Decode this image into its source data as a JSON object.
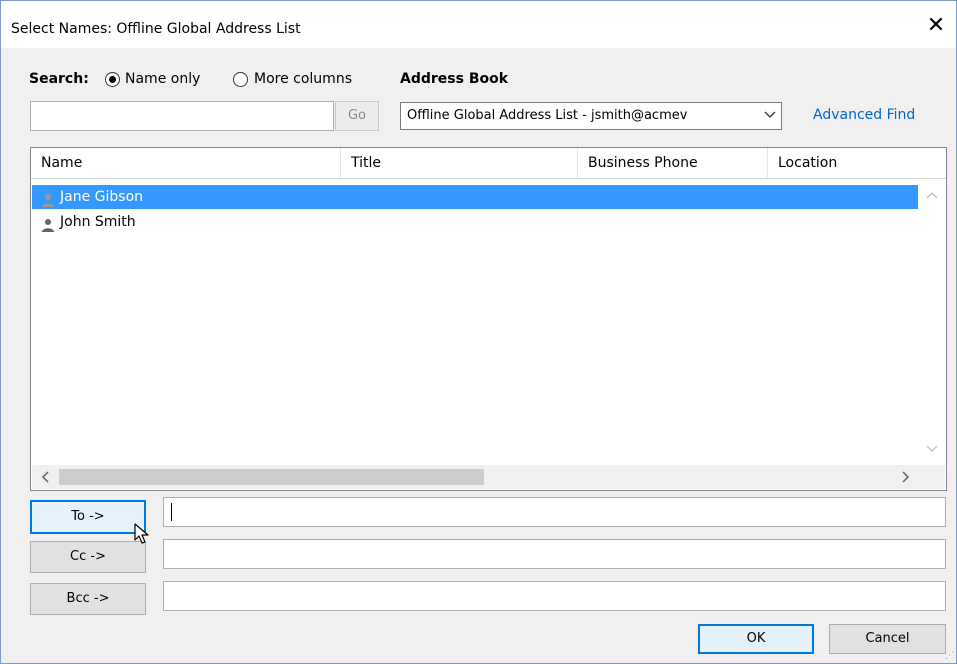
{
  "window": {
    "title": "Select Names: Offline Global Address List"
  },
  "search": {
    "label": "Search:",
    "option_name_only": "Name only",
    "option_more_columns": "More columns",
    "selected": "Name only",
    "query": "",
    "go_label": "Go"
  },
  "address_book": {
    "label": "Address Book",
    "selected": "Offline Global Address List - jsmith@acmev",
    "advanced_find": "Advanced Find"
  },
  "list": {
    "columns": [
      "Name",
      "Title",
      "Business Phone",
      "Location"
    ],
    "rows": [
      {
        "name": "Jane Gibson",
        "selected": true
      },
      {
        "name": "John Smith",
        "selected": false
      }
    ]
  },
  "recipients": {
    "to_label": "To ->",
    "cc_label": "Cc ->",
    "bcc_label": "Bcc ->",
    "to_value": "",
    "cc_value": "",
    "bcc_value": ""
  },
  "footer": {
    "ok_label": "OK",
    "cancel_label": "Cancel"
  },
  "colors": {
    "selection": "#3399ff",
    "link": "#0066cc",
    "focus": "#0078d7"
  }
}
